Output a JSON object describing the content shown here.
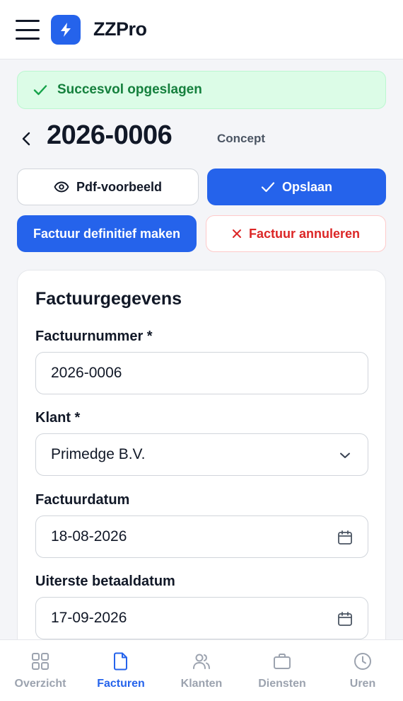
{
  "header": {
    "app_name": "ZZPro",
    "menu_icon": "hamburger-menu-icon",
    "logo_icon": "lightning-bolt-icon",
    "brand_color": "#2563eb"
  },
  "toast": {
    "message": "Succesvol opgeslagen",
    "icon": "check-icon",
    "color": "#15803d"
  },
  "invoice": {
    "number": "2026-0006",
    "status": "Concept"
  },
  "actions": {
    "preview_label": "Pdf-voorbeeld",
    "save_label": "Opslaan",
    "finalize_label": "Factuur definitief maken",
    "cancel_label": "Factuur annuleren",
    "danger_color": "#dc2626"
  },
  "form": {
    "title": "Factuurgegevens",
    "invoice_number": {
      "label": "Factuurnummer *",
      "value": "2026-0006"
    },
    "client": {
      "label": "Klant *",
      "value": "Primedge B.V."
    },
    "invoice_date": {
      "label": "Factuurdatum",
      "value": "18-08-2026"
    },
    "due_date": {
      "label": "Uiterste betaaldatum",
      "value": "17-09-2026"
    }
  },
  "nav": {
    "items": [
      {
        "label": "Overzicht",
        "icon": "grid-icon"
      },
      {
        "label": "Facturen",
        "icon": "document-icon",
        "active": true
      },
      {
        "label": "Klanten",
        "icon": "users-icon"
      },
      {
        "label": "Diensten",
        "icon": "briefcase-icon"
      },
      {
        "label": "Uren",
        "icon": "clock-icon"
      }
    ]
  }
}
